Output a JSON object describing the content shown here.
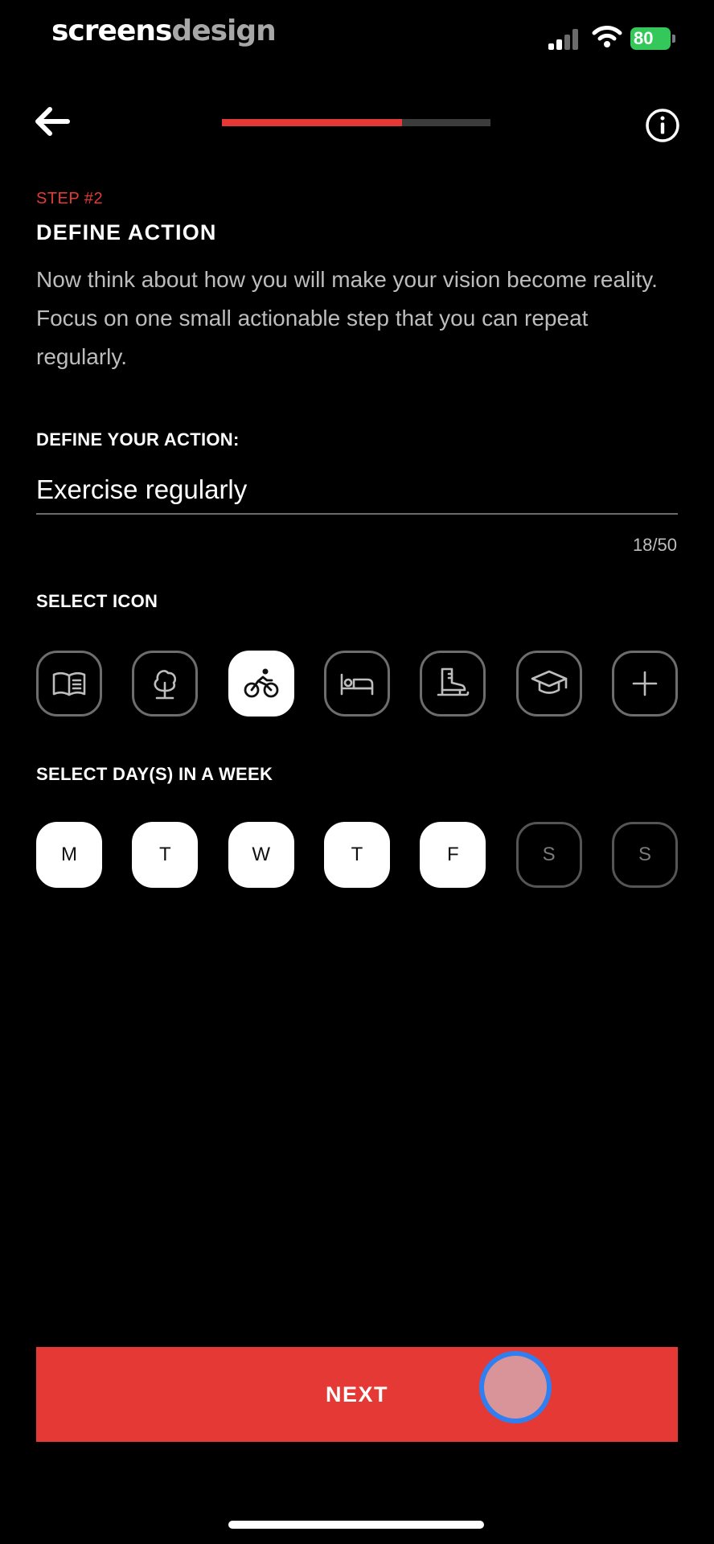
{
  "status_bar": {
    "brand_a": "screens",
    "brand_b": "design",
    "battery": "80"
  },
  "nav": {
    "progress_fraction": 0.67,
    "back_icon": "arrow-left-icon",
    "info_icon": "info-icon"
  },
  "step": {
    "number": "STEP #2",
    "title": "DEFINE ACTION",
    "description": "Now think about how you will make your vision become reality. Focus on one small actionable step that you can repeat regularly."
  },
  "action": {
    "label": "DEFINE YOUR ACTION:",
    "value": "Exercise regularly",
    "counter": "18/50"
  },
  "icons": {
    "label": "SELECT ICON",
    "items": [
      {
        "name": "book-icon",
        "selected": false
      },
      {
        "name": "tree-icon",
        "selected": false
      },
      {
        "name": "bicycle-icon",
        "selected": true
      },
      {
        "name": "bed-icon",
        "selected": false
      },
      {
        "name": "ice-skate-icon",
        "selected": false
      },
      {
        "name": "graduation-cap-icon",
        "selected": false
      },
      {
        "name": "plus-icon",
        "selected": false
      }
    ]
  },
  "days": {
    "label": "SELECT DAY(S) IN A WEEK",
    "items": [
      {
        "label": "M",
        "selected": true
      },
      {
        "label": "T",
        "selected": true
      },
      {
        "label": "W",
        "selected": true
      },
      {
        "label": "T",
        "selected": true
      },
      {
        "label": "F",
        "selected": true
      },
      {
        "label": "S",
        "selected": false
      },
      {
        "label": "S",
        "selected": false
      }
    ]
  },
  "next_button": "NEXT",
  "colors": {
    "accent": "#e53935",
    "background": "#000000",
    "battery": "#34c759",
    "touch_ring": "#2f7ff0"
  }
}
